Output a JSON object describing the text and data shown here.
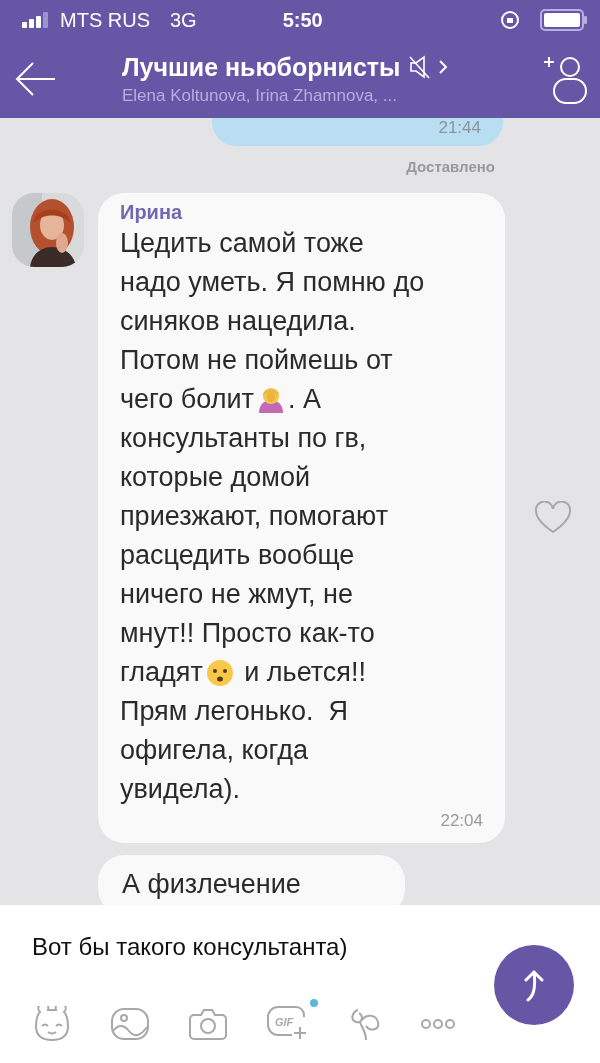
{
  "status_bar": {
    "carrier": "MTS RUS",
    "network": "3G",
    "time": "5:50"
  },
  "header": {
    "title": "Лучшие ньюборнисты",
    "muted": true,
    "subtitle": "Elena Koltunova, Irina Zhamnova, ..."
  },
  "messages": [
    {
      "kind": "outgoing",
      "time": "21:44",
      "status": "Доставлено"
    },
    {
      "kind": "incoming",
      "sender": "Ирина",
      "time": "22:04",
      "liked": false,
      "lines": [
        [
          {
            "kind": "text",
            "text": "Цедить самой тоже"
          }
        ],
        [
          {
            "kind": "text",
            "text": "надо уметь. Я помню до"
          }
        ],
        [
          {
            "kind": "text",
            "text": "синяков нацедила."
          }
        ],
        [
          {
            "kind": "text",
            "text": "Потом не поймешь от"
          }
        ],
        [
          {
            "kind": "text",
            "text": "чего болит"
          },
          {
            "kind": "facepalm"
          },
          {
            "kind": "text",
            "text": ". А"
          }
        ],
        [
          {
            "kind": "text",
            "text": "консультанты по гв,"
          }
        ],
        [
          {
            "kind": "text",
            "text": "которые домой"
          }
        ],
        [
          {
            "kind": "text",
            "text": "приезжают, помогают"
          }
        ],
        [
          {
            "kind": "text",
            "text": "расцедить вообще"
          }
        ],
        [
          {
            "kind": "text",
            "text": "ничего не жмут, не"
          }
        ],
        [
          {
            "kind": "text",
            "text": "мнут!! Просто как-то"
          }
        ],
        [
          {
            "kind": "text",
            "text": "гладят"
          },
          {
            "kind": "worried"
          },
          {
            "kind": "text",
            "text": " и льется!!"
          }
        ],
        [
          {
            "kind": "text",
            "text": "Прям легонько.  Я"
          }
        ],
        [
          {
            "kind": "text",
            "text": "офигела, когда"
          }
        ],
        [
          {
            "kind": "text",
            "text": "увидела)."
          }
        ]
      ]
    },
    {
      "kind": "incoming_partial",
      "text": "А физлечение"
    }
  ],
  "composer": {
    "value": "Вот бы такого консультанта)",
    "gif_label": "GIF",
    "gif_new": true
  }
}
